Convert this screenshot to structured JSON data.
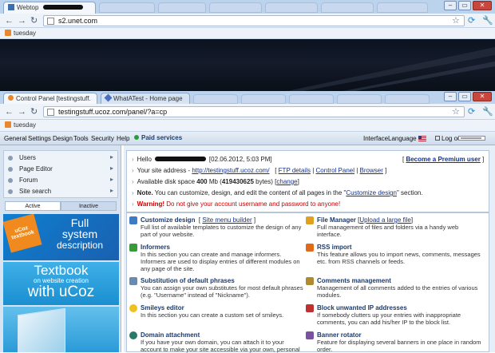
{
  "outer_browser": {
    "tab_title": "Webtop",
    "url": "s2.unet.com",
    "bookmark": "tuesday",
    "window_buttons": [
      "–",
      "▭",
      "✕"
    ]
  },
  "inner_browser": {
    "tab_active": "Control Panel [testingstuff.",
    "tab_second": "WhatATest - Home page",
    "url": "testingstuff.ucoz.com/panel/?a=cp",
    "bookmark": "tuesday"
  },
  "menu": {
    "items": [
      "General",
      "Settings",
      "Design",
      "Tools",
      "Security",
      "Help"
    ],
    "paid": "Paid services",
    "interface": "Interface",
    "language": "Language",
    "logout": "Log out"
  },
  "sidebar": {
    "items": [
      "Users",
      "Page Editor",
      "Forum",
      "Site search"
    ],
    "tab_active": "Active",
    "tab_inactive": "Inactive"
  },
  "ads": {
    "ad1_line1": "Full",
    "ad1_line2": "system",
    "ad1_line3": "description",
    "ad1_brand": "uCoz",
    "ad1_badge": "uCoz textbook",
    "ad2_line1": "Textbook",
    "ad2_line2": "on website creation",
    "ad2_line3": "with uCoz"
  },
  "info": {
    "hello": "Hello",
    "datetime": "[02.06.2012, 5:03 PM]",
    "premium": "Become a Premium user",
    "site_label": "Your site address -",
    "site_url": "http://testingstuff.ucoz.com/",
    "ftp": "FTP details",
    "cp": "Control Panel",
    "browser": "Browser",
    "disk_a": "Available disk space",
    "disk_mb": "400",
    "disk_b": "Mb (",
    "disk_bytes": "419430625",
    "disk_c": "bytes)",
    "change": "change",
    "note_label": "Note.",
    "note_text": "You can customize, design, and edit the content of all pages in the \"",
    "note_link": "Customize design",
    "note_end": "\" section.",
    "warning_label": "Warning!",
    "warning_text": "Do not give your account username and password to anyone!"
  },
  "features": [
    {
      "title": "Customize design",
      "extra": "Site menu builder",
      "desc": "Full list of available templates to customize the design of any part of your website.",
      "color": "#3c7cc4"
    },
    {
      "title": "File Manager",
      "extra": "Upload a large file",
      "desc": "Full management of files and folders via a handy web interface.",
      "color": "#e0a020"
    },
    {
      "title": "Informers",
      "extra": "",
      "desc": "In this section you can create and manage informers. Informers are used to display entries of different modules on any page of the site.",
      "color": "#3a9a3a"
    },
    {
      "title": "RSS import",
      "extra": "",
      "desc": "This feature allows you to import news, comments, messages etc. from RSS channels or feeds.",
      "color": "#e06a1a"
    },
    {
      "title": "Substitution of default phrases",
      "extra": "",
      "desc": "You can assign your own substitutes for most default phrases (e.g. \"Username\" instead of \"Nickname\").",
      "color": "#6a8ab0"
    },
    {
      "title": "Comments management",
      "extra": "",
      "desc": "Management of all comments added to the entries of various modules.",
      "color": "#b08a30"
    },
    {
      "title": "Smileys editor",
      "extra": "",
      "desc": "In this section you can create a custom set of smileys.",
      "color": "#f0c020"
    },
    {
      "title": "Block unwanted IP addresses",
      "extra": "",
      "desc": "If somebody clutters up your entries with inappropriate comments, you can add his/her IP to the block list.",
      "color": "#c03030"
    },
    {
      "title": "Domain attachment",
      "extra": "",
      "desc": "If you have your own domain, you can attach it to your account to make your site accessible via your own, personal",
      "color": "#2a7a6a"
    },
    {
      "title": "Banner rotator",
      "extra": "",
      "desc": "Feature for displaying several banners in one place in random order.",
      "color": "#7a50a0"
    }
  ]
}
